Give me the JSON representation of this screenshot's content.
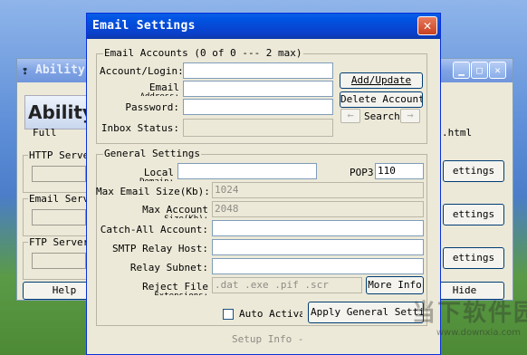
{
  "background_window": {
    "title": "Ability",
    "logo_text": "Ability",
    "full_text": "Full",
    "html_text": ".html",
    "groups": [
      {
        "label": "HTTP Server",
        "button": "ettings"
      },
      {
        "label": "Email Serv",
        "button": "ettings"
      },
      {
        "label": "FTP Server",
        "button": "ettings"
      }
    ],
    "help_button": "Help",
    "hide_button": "Hide",
    "min_icon": "minimize-icon",
    "max_icon": "maximize-icon",
    "close_icon": "close-icon"
  },
  "dialog": {
    "title": "Email Settings",
    "close_glyph": "✕",
    "accounts_group": {
      "label": "Email Accounts (0 of 0 --- 2 max)",
      "account_login_label": "Account/Login:",
      "email_label": "Email",
      "email_label_sub": "Address:",
      "password_label": "Password:",
      "inbox_status_label": "Inbox Status:",
      "add_update_button": "Add/Update",
      "delete_account_button": "Delete Account",
      "search_label": "Search",
      "prev_glyph": "←",
      "next_glyph": "→"
    },
    "general_group": {
      "label": "General Settings",
      "local_domain_label": "Local",
      "local_domain_label_sub": "Domain:",
      "pop3_label": "POP3",
      "pop3_value": "110",
      "max_email_size_label": "Max Email Size(Kb):",
      "max_email_size_value": "1024",
      "max_account_size_label": "Max Account",
      "max_account_size_label_sub": "Size(Kb):",
      "max_account_size_value": "2048",
      "catch_all_label": "Catch-All Account:",
      "smtp_relay_label": "SMTP Relay Host:",
      "relay_subnet_label": "Relay Subnet:",
      "reject_file_label": "Reject File",
      "reject_file_label_sub": "Extensions:",
      "reject_file_value": ".dat .exe .pif .scr",
      "more_info_button": "More Info",
      "auto_activate_label": "Auto Activa",
      "apply_button": "Apply General Settings"
    },
    "setup_info_label": "Setup Info -"
  },
  "watermark": {
    "text": "当下软件园",
    "sub": "www.downxia.com"
  }
}
